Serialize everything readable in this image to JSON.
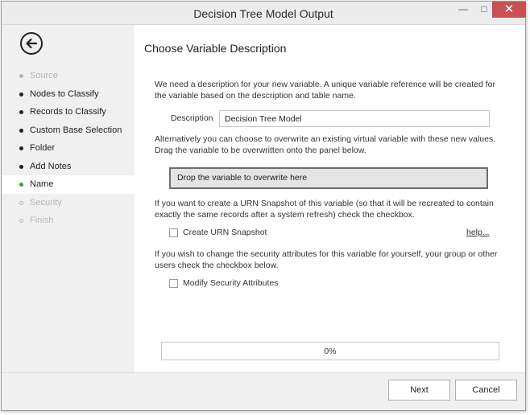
{
  "window": {
    "title": "Decision Tree Model Output"
  },
  "sidebar": {
    "steps": [
      {
        "label": "Source",
        "state": "disabled"
      },
      {
        "label": "Nodes to Classify",
        "state": "done"
      },
      {
        "label": "Records to Classify",
        "state": "done"
      },
      {
        "label": "Custom Base Selection",
        "state": "done"
      },
      {
        "label": "Folder",
        "state": "done"
      },
      {
        "label": "Add Notes",
        "state": "done"
      },
      {
        "label": "Name",
        "state": "active"
      },
      {
        "label": "Security",
        "state": "pending"
      },
      {
        "label": "Finish",
        "state": "pending"
      }
    ]
  },
  "main": {
    "heading": "Choose Variable Description",
    "intro": "We need a description for your new variable.  A unique variable reference will be created for the variable based on the description and table name.",
    "description_label": "Description",
    "description_value": "Decision Tree Model",
    "overwrite_text": "Alternatively you can choose to overwrite an existing virtual variable with these new values. Drag the variable to be overwritten onto the panel below.",
    "drop_zone": "Drop the variable to overwrite here",
    "urn_text": "If you want to create a URN Snapshot of this variable (so that it will be recreated to contain exactly the same records after a system refresh) check the checkbox.",
    "urn_checkbox": "Create URN Snapshot",
    "urn_checked": false,
    "help_link": "help...",
    "security_text": "If you wish to change the security attributes for this variable for yourself, your group or other users check the checkbox below.",
    "security_checkbox": "Modify Security Attributes",
    "security_checked": false,
    "progress_text": "0%",
    "progress_value": 0
  },
  "footer": {
    "next_label": "Next",
    "cancel_label": "Cancel"
  },
  "colors": {
    "active_dot": "#3c9a3c",
    "close_button": "#c75050",
    "disabled_text": "#b5b5b5"
  }
}
